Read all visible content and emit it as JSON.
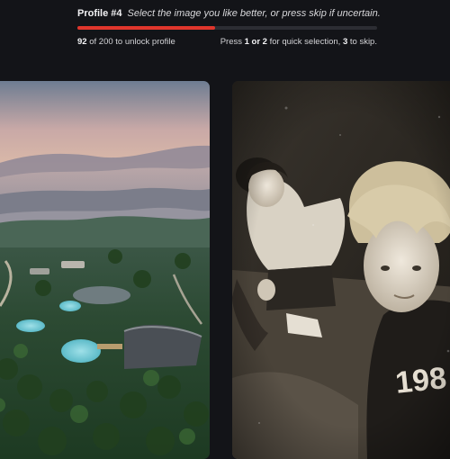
{
  "header": {
    "profile_label": "Profile #4",
    "instruction": "Select the image you like better, or press skip if uncertain.",
    "progress": {
      "current": "92",
      "text_rest": " of 200 to unlock profile",
      "fraction": 0.46
    },
    "hint": {
      "prefix": "Press ",
      "keys_a": "1 or 2",
      "middle": " for quick selection, ",
      "key_b": "3",
      "suffix": " to skip."
    }
  },
  "images": [
    {
      "name": "aerial-resort-landscape",
      "description_icon": "landscape-image"
    },
    {
      "name": "vintage-photo-two-teens",
      "description_icon": "portrait-image",
      "shirt_text": "198"
    }
  ],
  "colors": {
    "accent": "#e0362c",
    "background": "#131418",
    "track": "#2c2d33"
  }
}
